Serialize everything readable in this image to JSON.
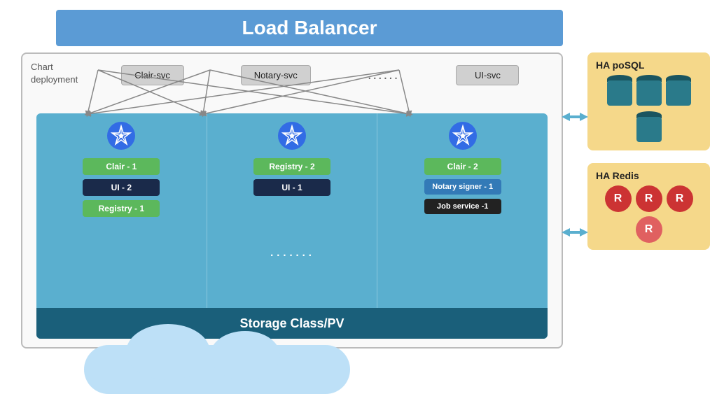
{
  "loadBalancer": {
    "label": "Load Balancer"
  },
  "chartLabel": {
    "line1": "Chart",
    "line2": "deployment"
  },
  "services": {
    "items": [
      {
        "label": "Clair-svc"
      },
      {
        "label": "Notary-svc"
      },
      {
        "label": "......"
      },
      {
        "label": "UI-svc"
      }
    ]
  },
  "storage": {
    "label": "Storage Class/PV"
  },
  "nodes": [
    {
      "pods": [
        {
          "label": "Clair - 1",
          "type": "green"
        },
        {
          "label": "UI - 2",
          "type": "dark"
        },
        {
          "label": "Registry - 1",
          "type": "green"
        }
      ]
    },
    {
      "dots": ".......",
      "pods": [
        {
          "label": "Registry - 2",
          "type": "green"
        },
        {
          "label": "UI - 1",
          "type": "dark"
        }
      ]
    },
    {
      "pods": [
        {
          "label": "Clair - 2",
          "type": "green"
        },
        {
          "label": "Notary signer - 1",
          "type": "blue"
        },
        {
          "label": "Job service -1",
          "type": "black"
        }
      ]
    }
  ],
  "haBoxes": [
    {
      "title": "HA poSQL",
      "type": "postgres",
      "dbCount": 4
    },
    {
      "title": "HA Redis",
      "type": "redis",
      "iconCount": 4
    }
  ],
  "arrows": {
    "color": "#5aafcf"
  }
}
